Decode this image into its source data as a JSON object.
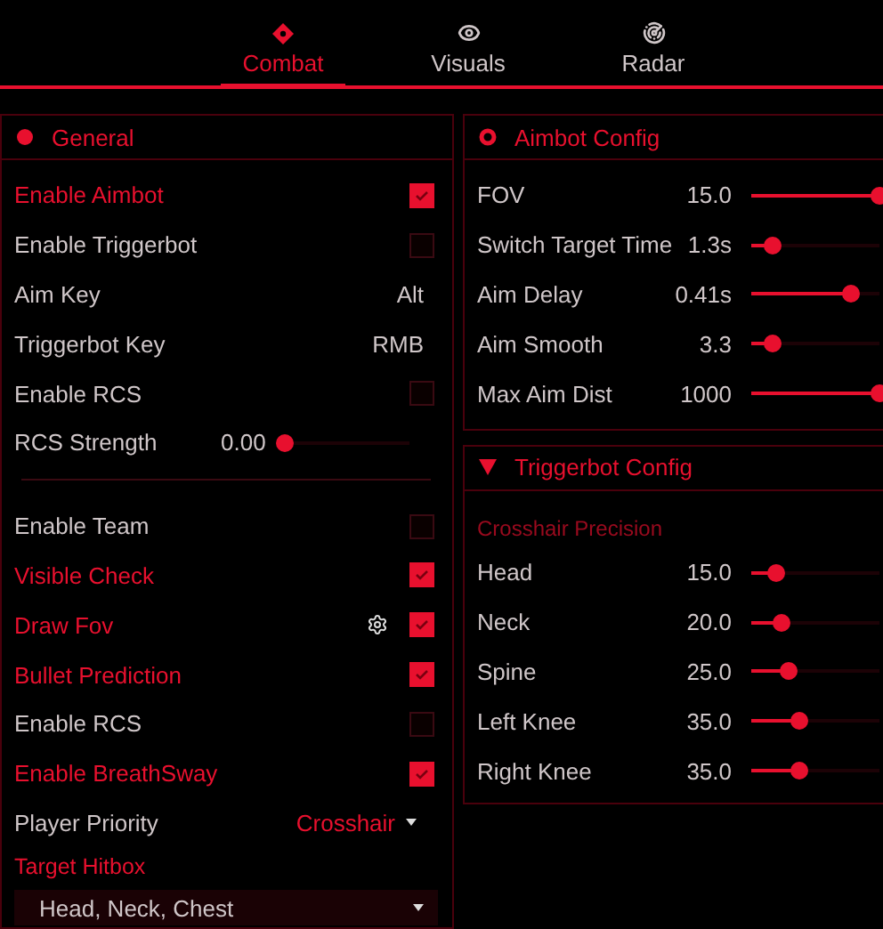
{
  "tabs": [
    {
      "label": "Combat",
      "selected": true
    },
    {
      "label": "Visuals",
      "selected": false
    },
    {
      "label": "Radar",
      "selected": false
    }
  ],
  "general": {
    "title": "General",
    "items": [
      {
        "kind": "checkbox",
        "label": "Enable Aimbot",
        "checked": true
      },
      {
        "kind": "checkbox",
        "label": "Enable Triggerbot",
        "checked": false
      },
      {
        "kind": "key",
        "label": "Aim Key",
        "value": "Alt"
      },
      {
        "kind": "key",
        "label": "Triggerbot Key",
        "value": "RMB"
      },
      {
        "kind": "checkbox",
        "label": "Enable RCS",
        "checked": false
      },
      {
        "kind": "slider",
        "label": "RCS Strength",
        "value": "0.00",
        "level": 0
      },
      {
        "kind": "divider"
      },
      {
        "kind": "checkbox",
        "label": "Enable Team",
        "checked": false
      },
      {
        "kind": "checkbox",
        "label": "Visible Check",
        "checked": true
      },
      {
        "kind": "checkbox",
        "label": "Draw Fov",
        "checked": true,
        "settings": true
      },
      {
        "kind": "checkbox",
        "label": "Bullet Prediction",
        "checked": true
      },
      {
        "kind": "checkbox",
        "label": "Enable RCS",
        "checked": false
      },
      {
        "kind": "checkbox",
        "label": "Enable BreathSway",
        "checked": true
      },
      {
        "kind": "dropdown",
        "label": "Player Priority",
        "value": "Crosshair"
      },
      {
        "kind": "heading",
        "label": "Target Hitbox"
      },
      {
        "kind": "select",
        "value": "Head, Neck, Chest"
      }
    ]
  },
  "aimbot_config": {
    "title": "Aimbot Config",
    "sliders": [
      {
        "label": "FOV",
        "value": "15.0",
        "level": 1
      },
      {
        "label": "Switch Target Time",
        "value": "1.3s",
        "level": 0.17
      },
      {
        "label": "Aim Delay",
        "value": "0.41s",
        "level": 0.78
      },
      {
        "label": "Aim Smooth",
        "value": "3.3",
        "level": 0.17
      },
      {
        "label": "Max Aim Dist",
        "value": "1000",
        "level": 1
      }
    ]
  },
  "triggerbot_config": {
    "title": "Triggerbot Config",
    "subtitle": "Crosshair Precision",
    "sliders": [
      {
        "label": "Head",
        "value": "15.0",
        "level": 0.2
      },
      {
        "label": "Neck",
        "value": "20.0",
        "level": 0.24
      },
      {
        "label": "Spine",
        "value": "25.0",
        "level": 0.29
      },
      {
        "label": "Left Knee",
        "value": "35.0",
        "level": 0.38
      },
      {
        "label": "Right Knee",
        "value": "35.0",
        "level": 0.38
      }
    ]
  }
}
